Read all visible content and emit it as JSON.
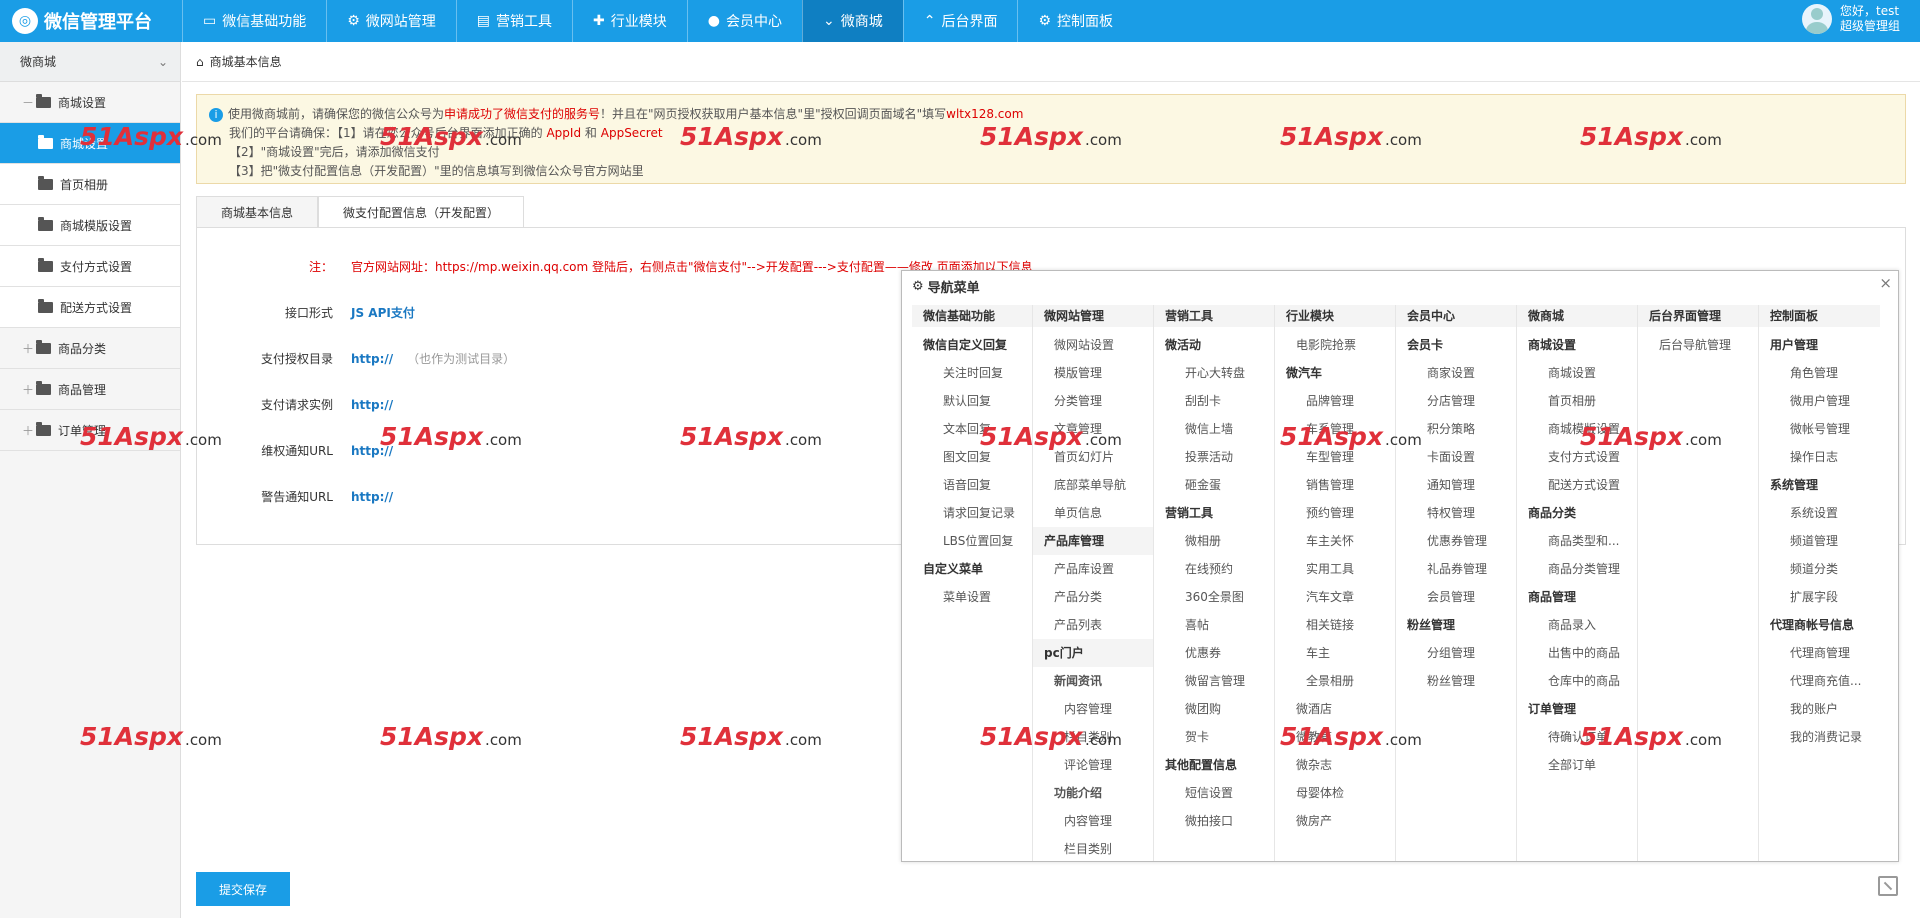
{
  "topbar": {
    "app_title": "微信管理平台",
    "nav": [
      {
        "label": "微信基础功能",
        "icon": "monitor-icon"
      },
      {
        "label": "微网站管理",
        "icon": "gear-icon"
      },
      {
        "label": "营销工具",
        "icon": "briefcase-icon"
      },
      {
        "label": "行业模块",
        "icon": "puzzle-icon"
      },
      {
        "label": "会员中心",
        "icon": "user-icon"
      },
      {
        "label": "微商城",
        "icon": "chevron-down-icon"
      },
      {
        "label": "后台界面",
        "icon": "chevron-up-icon"
      },
      {
        "label": "控制面板",
        "icon": "gear-icon"
      }
    ],
    "active_index": 5,
    "user_greeting": "您好，test",
    "user_role": "超级管理组"
  },
  "sidebar": {
    "header": "微商城",
    "items": [
      {
        "label": "商城设置",
        "level": 0,
        "toggle": "－"
      },
      {
        "label": "商城设置",
        "level": 1,
        "active": true
      },
      {
        "label": "首页相册",
        "level": 1
      },
      {
        "label": "商城模版设置",
        "level": 1
      },
      {
        "label": "支付方式设置",
        "level": 1
      },
      {
        "label": "配送方式设置",
        "level": 1
      },
      {
        "label": "商品分类",
        "level": 0,
        "toggle": "＋"
      },
      {
        "label": "商品管理",
        "level": 0,
        "toggle": "＋"
      },
      {
        "label": "订单管理",
        "level": 0,
        "toggle": "＋"
      }
    ]
  },
  "breadcrumb": "商城基本信息",
  "notice": {
    "line1_a": "使用微商城前，请确保您的微信公众号为",
    "line1_red": "申请成功了微信支付的服务号",
    "line1_b": "！并且在\"网页授权获取用户基本信息\"里\"授权回调页面域名\"填写",
    "line1_domain": "wltx128.com",
    "line2_a": "我们的平台请确保：【1】请在您公众号后台界面添加正确的",
    "line2_appid": "AppId",
    "line2_and": "和",
    "line2_secret": "AppSecret",
    "line3": "【2】\"商城设置\"完后，请添加微信支付",
    "line4": "【3】把\"微支付配置信息（开发配置）\"里的信息填写到微信公众号官方网站里"
  },
  "tabs": [
    {
      "label": "商城基本信息",
      "active": false
    },
    {
      "label": "微支付配置信息（开发配置）",
      "active": true
    }
  ],
  "form": {
    "note_label": "注：",
    "note_value": "官方网站网址：https://mp.weixin.qq.com 登陆后，右侧点击\"微信支付\"-->开发配置--->支付配置——修改 页面添加以下信息",
    "interface_label": "接口形式",
    "interface_value": "JS API支付",
    "auth_dir_label": "支付授权目录",
    "auth_dir_value": "http://",
    "auth_dir_hint": "（也作为测试目录）",
    "request_label": "支付请求实例",
    "request_value": "http://",
    "rights_label": "维权通知URL",
    "rights_value": "http://",
    "alert_label": "警告通知URL",
    "alert_value": "http://"
  },
  "submit_label": "提交保存",
  "popup": {
    "title": "导航菜单",
    "close": "×",
    "columns": [
      {
        "head": "微信基础功能",
        "items": [
          {
            "t": "微信自定义回复",
            "k": "g"
          },
          {
            "t": "关注时回复",
            "k": "l2"
          },
          {
            "t": "默认回复",
            "k": "l2"
          },
          {
            "t": "文本回复",
            "k": "l2"
          },
          {
            "t": "图文回复",
            "k": "l2"
          },
          {
            "t": "语音回复",
            "k": "l2"
          },
          {
            "t": "请求回复记录",
            "k": "l2"
          },
          {
            "t": "LBS位置回复",
            "k": "l2"
          },
          {
            "t": "自定义菜单",
            "k": "g"
          },
          {
            "t": "菜单设置",
            "k": "l2"
          }
        ]
      },
      {
        "head": "微网站管理",
        "items": [
          {
            "t": "微网站设置",
            "k": "l1"
          },
          {
            "t": "模版管理",
            "k": "l1"
          },
          {
            "t": "分类管理",
            "k": "l1"
          },
          {
            "t": "文章管理",
            "k": "l1"
          },
          {
            "t": "首页幻灯片",
            "k": "l1"
          },
          {
            "t": "底部菜单导航",
            "k": "l1"
          },
          {
            "t": "单页信息",
            "k": "l1"
          },
          {
            "t": "产品库管理",
            "k": "g",
            "hl": true
          },
          {
            "t": "产品库设置",
            "k": "l1"
          },
          {
            "t": "产品分类",
            "k": "l1"
          },
          {
            "t": "产品列表",
            "k": "l1"
          },
          {
            "t": "pc门户",
            "k": "g",
            "hl": true
          },
          {
            "t": "新闻资讯",
            "k": "l1",
            "bold": true
          },
          {
            "t": "内容管理",
            "k": "l2"
          },
          {
            "t": "栏目类别",
            "k": "l2"
          },
          {
            "t": "评论管理",
            "k": "l2"
          },
          {
            "t": "功能介绍",
            "k": "l1",
            "bold": true
          },
          {
            "t": "内容管理",
            "k": "l2"
          },
          {
            "t": "栏目类别",
            "k": "l2"
          }
        ]
      },
      {
        "head": "营销工具",
        "items": [
          {
            "t": "微活动",
            "k": "g"
          },
          {
            "t": "开心大转盘",
            "k": "l2"
          },
          {
            "t": "刮刮卡",
            "k": "l2"
          },
          {
            "t": "微信上墙",
            "k": "l2"
          },
          {
            "t": "投票活动",
            "k": "l2"
          },
          {
            "t": "砸金蛋",
            "k": "l2"
          },
          {
            "t": "营销工具",
            "k": "g"
          },
          {
            "t": "微相册",
            "k": "l2"
          },
          {
            "t": "在线预约",
            "k": "l2"
          },
          {
            "t": "360全景图",
            "k": "l2"
          },
          {
            "t": "喜帖",
            "k": "l2"
          },
          {
            "t": "优惠券",
            "k": "l2"
          },
          {
            "t": "微留言管理",
            "k": "l2"
          },
          {
            "t": "微团购",
            "k": "l2"
          },
          {
            "t": "贺卡",
            "k": "l2"
          },
          {
            "t": "其他配置信息",
            "k": "g"
          },
          {
            "t": "短信设置",
            "k": "l2"
          },
          {
            "t": "微拍接口",
            "k": "l2"
          }
        ]
      },
      {
        "head": "行业模块",
        "items": [
          {
            "t": "电影院抢票",
            "k": "l1"
          },
          {
            "t": "微汽车",
            "k": "g"
          },
          {
            "t": "品牌管理",
            "k": "l2"
          },
          {
            "t": "车系管理",
            "k": "l2"
          },
          {
            "t": "车型管理",
            "k": "l2"
          },
          {
            "t": "销售管理",
            "k": "l2"
          },
          {
            "t": "预约管理",
            "k": "l2"
          },
          {
            "t": "车主关怀",
            "k": "l2"
          },
          {
            "t": "实用工具",
            "k": "l2"
          },
          {
            "t": "汽车文章",
            "k": "l2"
          },
          {
            "t": "相关链接",
            "k": "l2"
          },
          {
            "t": "车主",
            "k": "l2"
          },
          {
            "t": "全景相册",
            "k": "l2"
          },
          {
            "t": "微酒店",
            "k": "l1"
          },
          {
            "t": "微教育",
            "k": "l1"
          },
          {
            "t": "微杂志",
            "k": "l1"
          },
          {
            "t": "母婴体检",
            "k": "l1"
          },
          {
            "t": "微房产",
            "k": "l1"
          }
        ]
      },
      {
        "head": "会员中心",
        "items": [
          {
            "t": "会员卡",
            "k": "g"
          },
          {
            "t": "商家设置",
            "k": "l2"
          },
          {
            "t": "分店管理",
            "k": "l2"
          },
          {
            "t": "积分策略",
            "k": "l2"
          },
          {
            "t": "卡面设置",
            "k": "l2"
          },
          {
            "t": "通知管理",
            "k": "l2"
          },
          {
            "t": "特权管理",
            "k": "l2"
          },
          {
            "t": "优惠券管理",
            "k": "l2"
          },
          {
            "t": "礼品券管理",
            "k": "l2"
          },
          {
            "t": "会员管理",
            "k": "l2"
          },
          {
            "t": "粉丝管理",
            "k": "g"
          },
          {
            "t": "分组管理",
            "k": "l2"
          },
          {
            "t": "粉丝管理",
            "k": "l2"
          }
        ]
      },
      {
        "head": "微商城",
        "items": [
          {
            "t": "商城设置",
            "k": "g"
          },
          {
            "t": "商城设置",
            "k": "l2"
          },
          {
            "t": "首页相册",
            "k": "l2"
          },
          {
            "t": "商城模版设置",
            "k": "l2"
          },
          {
            "t": "支付方式设置",
            "k": "l2"
          },
          {
            "t": "配送方式设置",
            "k": "l2"
          },
          {
            "t": "商品分类",
            "k": "g"
          },
          {
            "t": "商品类型和...",
            "k": "l2"
          },
          {
            "t": "商品分类管理",
            "k": "l2"
          },
          {
            "t": "商品管理",
            "k": "g"
          },
          {
            "t": "商品录入",
            "k": "l2"
          },
          {
            "t": "出售中的商品",
            "k": "l2"
          },
          {
            "t": "仓库中的商品",
            "k": "l2"
          },
          {
            "t": "订单管理",
            "k": "g"
          },
          {
            "t": "待确认订单",
            "k": "l2"
          },
          {
            "t": "全部订单",
            "k": "l2"
          }
        ]
      },
      {
        "head": "后台界面管理",
        "items": [
          {
            "t": "后台导航管理",
            "k": "l1"
          }
        ]
      },
      {
        "head": "控制面板",
        "items": [
          {
            "t": "用户管理",
            "k": "g"
          },
          {
            "t": "角色管理",
            "k": "l2"
          },
          {
            "t": "微用户管理",
            "k": "l2"
          },
          {
            "t": "微帐号管理",
            "k": "l2"
          },
          {
            "t": "操作日志",
            "k": "l2"
          },
          {
            "t": "系统管理",
            "k": "g"
          },
          {
            "t": "系统设置",
            "k": "l2"
          },
          {
            "t": "频道管理",
            "k": "l2"
          },
          {
            "t": "频道分类",
            "k": "l2"
          },
          {
            "t": "扩展字段",
            "k": "l2"
          },
          {
            "t": "代理商帐号信息",
            "k": "g"
          },
          {
            "t": "代理商管理",
            "k": "l2"
          },
          {
            "t": "代理商充值...",
            "k": "l2"
          },
          {
            "t": "我的账户",
            "k": "l2"
          },
          {
            "t": "我的消费记录",
            "k": "l2"
          }
        ]
      }
    ]
  },
  "watermark": {
    "big": "51Aspx",
    "small": ".com"
  }
}
